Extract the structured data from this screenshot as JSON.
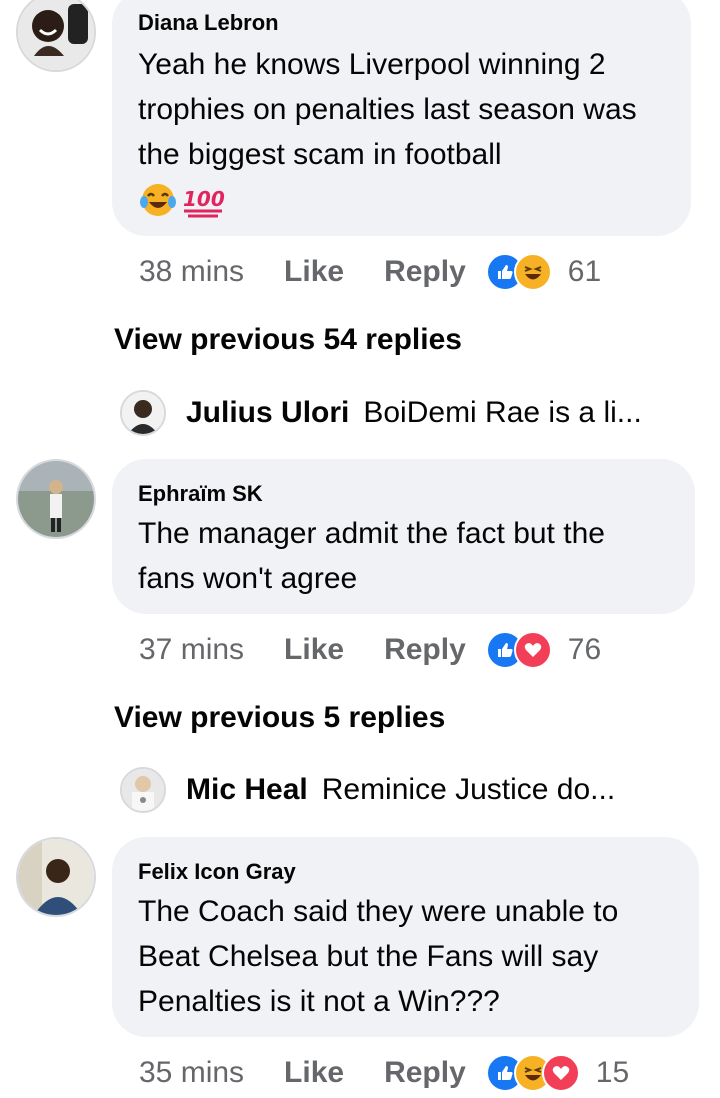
{
  "comments": [
    {
      "author": "Diana Lebron",
      "text": "Yeah he knows Liverpool winning 2 trophies on penalties last season was the biggest scam in football",
      "emoji": [
        "laughing-tears-emoji",
        "hundred-points-emoji"
      ],
      "time": "38 mins",
      "like_label": "Like",
      "reply_label": "Reply",
      "reactions": [
        "like",
        "haha"
      ],
      "reaction_count": "61",
      "view_previous": "View previous 54 replies",
      "reply_preview": {
        "name": "Julius Ulori",
        "text": "BoiDemi Rae is a li..."
      }
    },
    {
      "author": "Ephraïm SK",
      "text": "The manager admit the fact but the fans won't agree",
      "time": "37 mins",
      "like_label": "Like",
      "reply_label": "Reply",
      "reactions": [
        "like",
        "love"
      ],
      "reaction_count": "76",
      "view_previous": "View previous 5 replies",
      "reply_preview": {
        "name": "Mic Heal",
        "text": "Reminice Justice do..."
      }
    },
    {
      "author": "Felix Icon Gray",
      "text": "The Coach said they were unable to Beat Chelsea but the Fans will say Penalties is it not a Win???",
      "time": "35 mins",
      "like_label": "Like",
      "reply_label": "Reply",
      "reactions": [
        "like",
        "haha",
        "love"
      ],
      "reaction_count": "15"
    }
  ],
  "colors": {
    "bubble": "#f0f2f5",
    "meta_text": "#65676b",
    "like_blue": "#1877f2",
    "love_red": "#f33e58",
    "haha_yellow": "#f7b125"
  }
}
